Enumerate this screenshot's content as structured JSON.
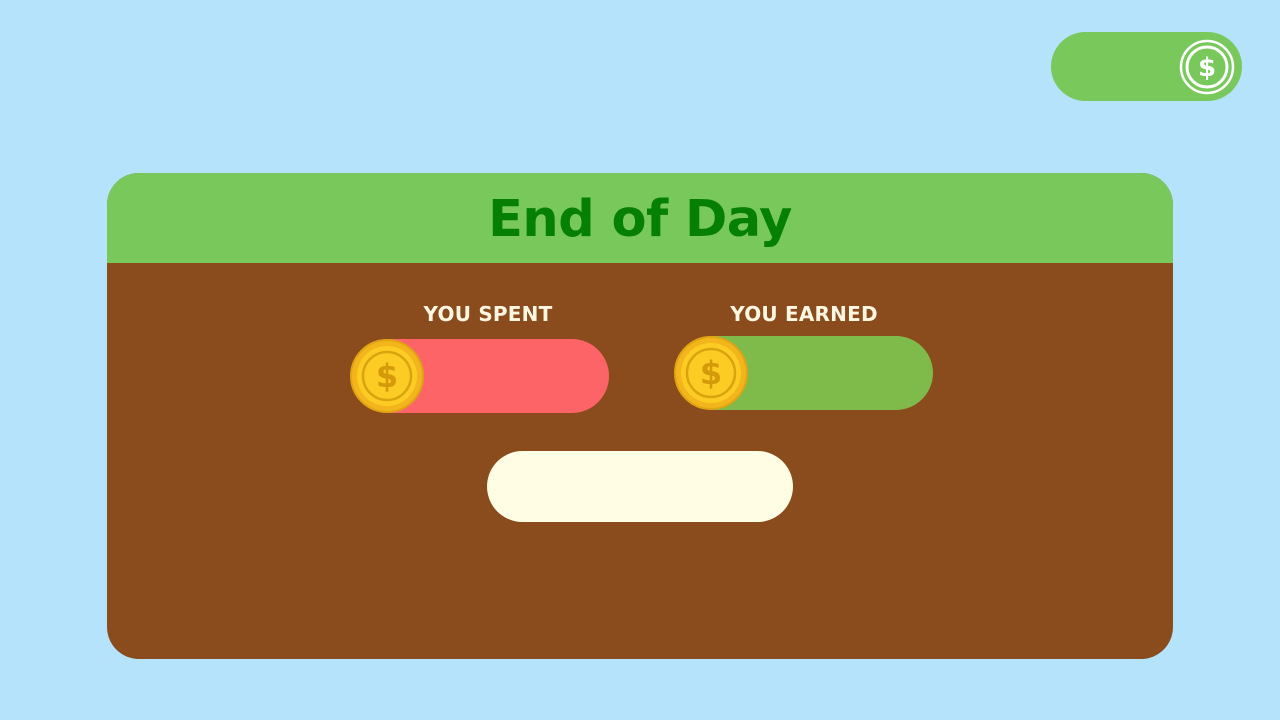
{
  "balance": {
    "value": "",
    "icon": "dollar-coin-outline-icon"
  },
  "end_of_day": {
    "title": "End of Day",
    "spent": {
      "label": "YOU SPENT",
      "value": "",
      "color": "#fd6467",
      "icon": "gold-coin-icon"
    },
    "earned": {
      "label": "YOU EARNED",
      "value": "",
      "color": "#7fbb4b",
      "icon": "gold-coin-icon"
    },
    "continue_button": {
      "label": ""
    }
  },
  "colors": {
    "background": "#b5e3fc",
    "header_green": "#78c85c",
    "title_green": "#058005",
    "panel_brown": "#8a4b1d",
    "coin_gold": "#fccc24",
    "button_cream": "#fffde4"
  }
}
